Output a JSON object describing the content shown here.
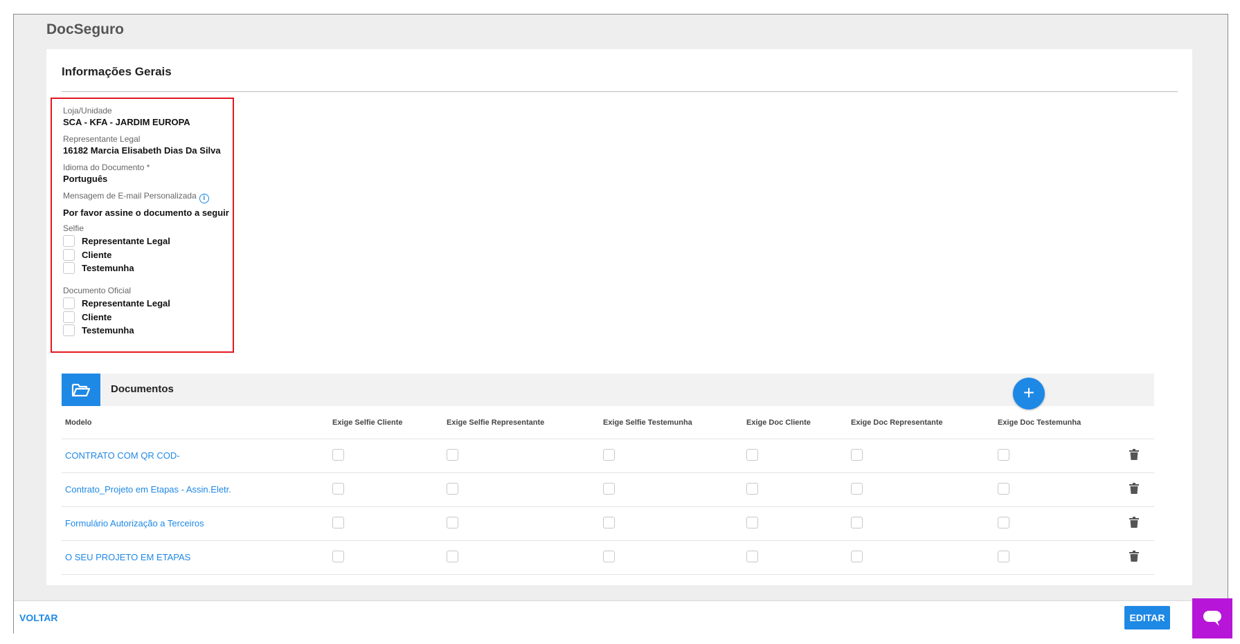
{
  "app": {
    "title": "DocSeguro"
  },
  "section": {
    "title": "Informações Gerais"
  },
  "info": {
    "store_label": "Loja/Unidade",
    "store_value": "SCA - KFA - JARDIM EUROPA",
    "rep_label": "Representante Legal",
    "rep_value": "16182  Marcia Elisabeth Dias Da Silva",
    "lang_label": "Idioma do Documento *",
    "lang_value": "Português",
    "email_label": "Mensagem de E-mail Personalizada",
    "email_value": "Por favor assine o documento a seguir",
    "selfie_label": "Selfie",
    "selfie_options": [
      "Representante Legal",
      "Cliente",
      "Testemunha"
    ],
    "official_label": "Documento Oficial",
    "official_options": [
      "Representante Legal",
      "Cliente",
      "Testemunha"
    ]
  },
  "documents": {
    "title": "Documentos",
    "columns": [
      "Modelo",
      "Exige Selfie Cliente",
      "Exige Selfie Representante",
      "Exige Selfie Testemunha",
      "Exige Doc Cliente",
      "Exige Doc Representante",
      "Exige Doc Testemunha"
    ],
    "rows": [
      {
        "model": "CONTRATO COM QR COD-"
      },
      {
        "model": "Contrato_Projeto em Etapas - Assin.Eletr."
      },
      {
        "model": "Formulário Autorização a Terceiros"
      },
      {
        "model": "O SEU PROJETO EM ETAPAS"
      }
    ]
  },
  "footer": {
    "back_label": "VOLTAR",
    "edit_label": "EDITAR"
  },
  "colors": {
    "accent": "#1e88e5",
    "highlight_border": "#e3161f",
    "chat_widget": "#b716d8"
  }
}
